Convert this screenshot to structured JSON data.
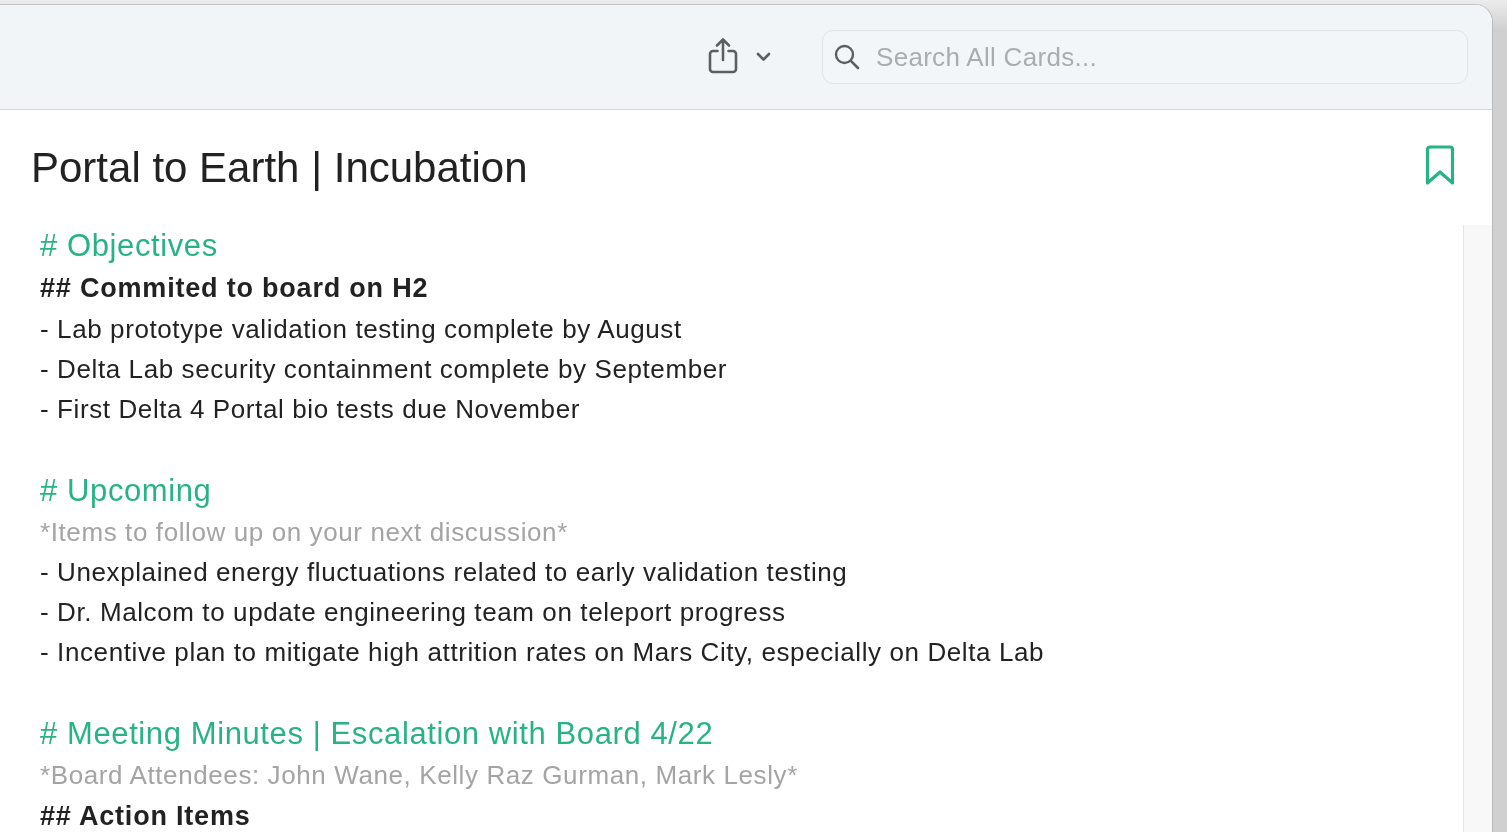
{
  "toolbar": {
    "search": {
      "placeholder": "Search All Cards..."
    }
  },
  "card": {
    "title": "Portal to Earth | Incubation",
    "sections": [
      {
        "lines": [
          {
            "kind": "h1",
            "text": "# Objectives"
          },
          {
            "kind": "h2",
            "text": "## Commited to board on H2"
          },
          {
            "kind": "bullet",
            "text": "- Lab prototype validation testing complete by August"
          },
          {
            "kind": "bullet",
            "text": "- Delta Lab security containment complete by September"
          },
          {
            "kind": "bullet",
            "text": "- First Delta 4 Portal bio tests due November"
          }
        ]
      },
      {
        "lines": [
          {
            "kind": "h1",
            "text": "# Upcoming"
          },
          {
            "kind": "note",
            "text": "*Items to follow up on your next discussion*"
          },
          {
            "kind": "bullet",
            "text": "- Unexplained energy fluctuations related to early validation testing"
          },
          {
            "kind": "bullet",
            "text": "- Dr. Malcom to update engineering team on teleport progress"
          },
          {
            "kind": "bullet",
            "text": "- Incentive plan to mitigate high attrition rates on Mars City, especially on Delta Lab"
          }
        ]
      },
      {
        "lines": [
          {
            "kind": "h1",
            "text": "# Meeting Minutes | Escalation with Board 4/22"
          },
          {
            "kind": "note",
            "text": "*Board Attendees: John Wane, Kelly Raz Gurman, Mark Lesly*"
          },
          {
            "kind": "h2",
            "text": "## Action Items"
          }
        ]
      }
    ]
  }
}
